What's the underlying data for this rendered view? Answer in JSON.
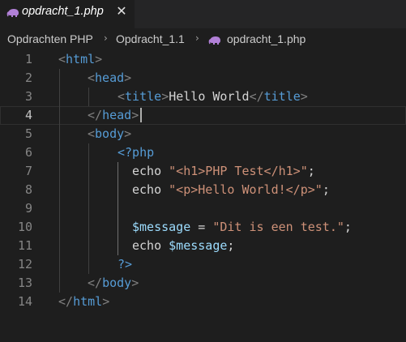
{
  "tab": {
    "title": "opdracht_1.php",
    "icon": "php-elephant-icon",
    "close_glyph": "✕"
  },
  "breadcrumb": {
    "folder": "Opdrachten PHP",
    "subfolder": "Opdracht_1.1",
    "file": "opdracht_1.php",
    "separator": "›"
  },
  "editor": {
    "active_line": 4,
    "lines": [
      {
        "n": "1",
        "tokens": [
          [
            "t-br",
            "<"
          ],
          [
            "t-tag",
            "html"
          ],
          [
            "t-br",
            ">"
          ]
        ]
      },
      {
        "n": "2",
        "tokens": [
          [
            "t-br",
            "<"
          ],
          [
            "t-tag",
            "head"
          ],
          [
            "t-br",
            ">"
          ]
        ]
      },
      {
        "n": "3",
        "tokens": [
          [
            "t-br",
            "<"
          ],
          [
            "t-tag",
            "title"
          ],
          [
            "t-br",
            ">"
          ],
          [
            "t-txt",
            "Hello World"
          ],
          [
            "t-br",
            "</"
          ],
          [
            "t-tag",
            "title"
          ],
          [
            "t-br",
            ">"
          ]
        ]
      },
      {
        "n": "4",
        "tokens": [
          [
            "t-br",
            "</"
          ],
          [
            "t-tag",
            "head"
          ],
          [
            "t-br",
            ">"
          ]
        ]
      },
      {
        "n": "5",
        "tokens": [
          [
            "t-br",
            "<"
          ],
          [
            "t-tag",
            "body"
          ],
          [
            "t-br",
            ">"
          ]
        ]
      },
      {
        "n": "6",
        "tokens": [
          [
            "t-tag",
            "<?php"
          ]
        ]
      },
      {
        "n": "7",
        "tokens": [
          [
            "t-txt",
            "echo "
          ],
          [
            "t-str",
            "\"<h1>PHP Test</h1>\""
          ],
          [
            "t-txt",
            ";"
          ]
        ]
      },
      {
        "n": "8",
        "tokens": [
          [
            "t-txt",
            "echo "
          ],
          [
            "t-str",
            "\"<p>Hello World!</p>\""
          ],
          [
            "t-txt",
            ";"
          ]
        ]
      },
      {
        "n": "9",
        "tokens": []
      },
      {
        "n": "10",
        "tokens": [
          [
            "t-var",
            "$message"
          ],
          [
            "t-txt",
            " = "
          ],
          [
            "t-str",
            "\"Dit is een test.\""
          ],
          [
            "t-txt",
            ";"
          ]
        ]
      },
      {
        "n": "11",
        "tokens": [
          [
            "t-txt",
            "echo "
          ],
          [
            "t-var",
            "$message"
          ],
          [
            "t-txt",
            ";"
          ]
        ]
      },
      {
        "n": "12",
        "tokens": [
          [
            "t-tag",
            "?>"
          ]
        ]
      },
      {
        "n": "13",
        "tokens": [
          [
            "t-br",
            "</"
          ],
          [
            "t-tag",
            "body"
          ],
          [
            "t-br",
            ">"
          ]
        ]
      },
      {
        "n": "14",
        "tokens": [
          [
            "t-br",
            "</"
          ],
          [
            "t-tag",
            "html"
          ],
          [
            "t-br",
            ">"
          ]
        ]
      }
    ]
  },
  "colors": {
    "background": "#1e1e1e",
    "tabbar": "#252526",
    "tag": "#569cd6",
    "bracket": "#808080",
    "string": "#ce9178",
    "variable": "#9cdcfe",
    "text": "#d4d4d4",
    "line_number": "#858585",
    "php_icon": "#b180d7"
  }
}
